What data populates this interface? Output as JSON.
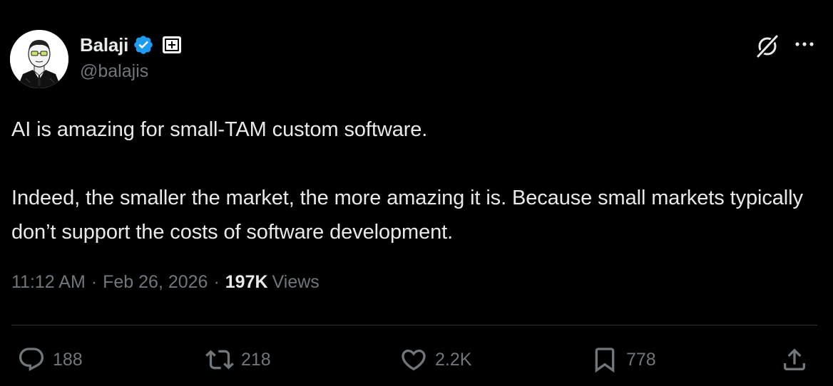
{
  "author": {
    "display_name": "Balaji",
    "handle": "@balajis",
    "verified_badge_color": "#1d9bf0",
    "icons": [
      "verified-badge-icon",
      "affiliate-badge-icon"
    ]
  },
  "header_icons": [
    "grok-icon",
    "more-icon"
  ],
  "tweet": {
    "paragraphs": [
      "AI is amazing for small-TAM custom software.",
      "Indeed, the smaller the market, the more amazing it is. Because small markets typically don’t support the costs of software development."
    ]
  },
  "meta": {
    "time": "11:12 AM",
    "separator": "·",
    "date": "Feb 26, 2026",
    "views_count": "197K",
    "views_label": "Views"
  },
  "actions": {
    "reply": {
      "icon": "reply-icon",
      "count": "188"
    },
    "repost": {
      "icon": "repost-icon",
      "count": "218"
    },
    "like": {
      "icon": "heart-icon",
      "count": "2.2K"
    },
    "bookmark": {
      "icon": "bookmark-icon",
      "count": "778"
    },
    "share": {
      "icon": "share-icon"
    }
  },
  "colors": {
    "background": "#000000",
    "text_primary": "#e7e9ea",
    "text_secondary": "#71767b",
    "divider": "#2f3336",
    "accent": "#1d9bf0"
  }
}
